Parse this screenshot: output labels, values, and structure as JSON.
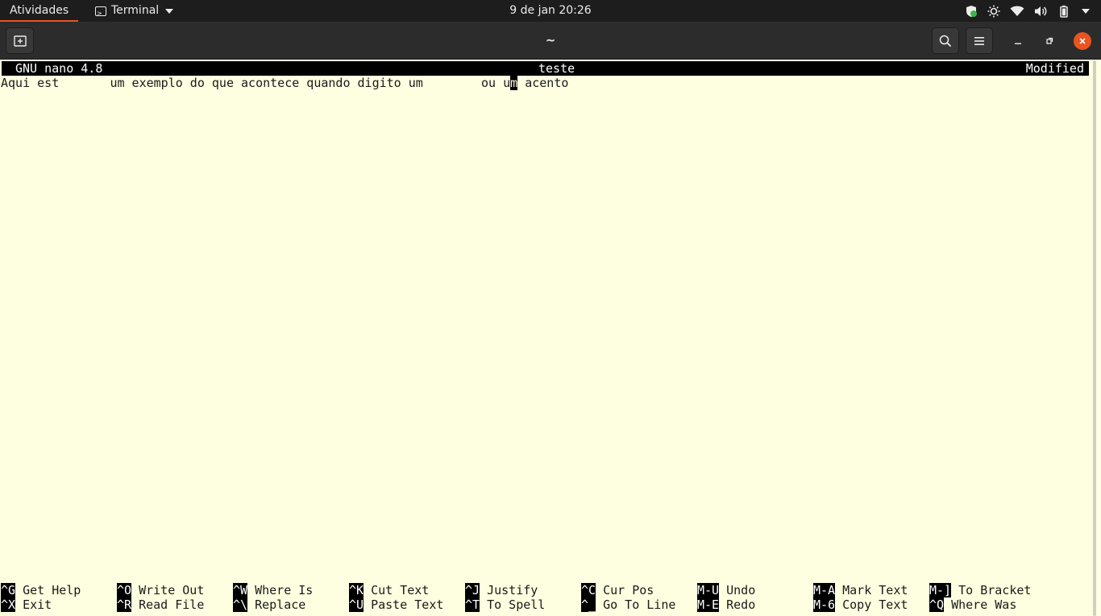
{
  "topbar": {
    "activities": "Atividades",
    "app_name": "Terminal",
    "clock": "9 de jan  20:26",
    "tray_icons": [
      "shield-icon",
      "brightness-icon",
      "wifi-icon",
      "volume-icon",
      "battery-icon",
      "system-menu-caret-icon"
    ]
  },
  "window": {
    "title": "~"
  },
  "nano": {
    "version": "GNU nano 4.8",
    "filename": "teste",
    "status": "Modified",
    "text_before_cursor": "Aqui est       um exemplo do que acontece quando digito um        ou u",
    "cursor_char": "m",
    "text_after_cursor": " acento",
    "shortcuts_row1": [
      {
        "key": "^G",
        "label": "Get Help"
      },
      {
        "key": "^O",
        "label": "Write Out"
      },
      {
        "key": "^W",
        "label": "Where Is"
      },
      {
        "key": "^K",
        "label": "Cut Text"
      },
      {
        "key": "^J",
        "label": "Justify"
      },
      {
        "key": "^C",
        "label": "Cur Pos"
      },
      {
        "key": "M-U",
        "label": "Undo"
      },
      {
        "key": "M-A",
        "label": "Mark Text"
      },
      {
        "key": "M-]",
        "label": "To Bracket"
      }
    ],
    "shortcuts_row2": [
      {
        "key": "^X",
        "label": "Exit"
      },
      {
        "key": "^R",
        "label": "Read File"
      },
      {
        "key": "^\\",
        "label": "Replace"
      },
      {
        "key": "^U",
        "label": "Paste Text"
      },
      {
        "key": "^T",
        "label": "To Spell"
      },
      {
        "key": "^_",
        "label": "Go To Line"
      },
      {
        "key": "M-E",
        "label": "Redo"
      },
      {
        "key": "M-6",
        "label": "Copy Text"
      },
      {
        "key": "^Q",
        "label": "Where Was"
      }
    ]
  },
  "colors": {
    "accent": "#e95420",
    "terminal_bg": "#fefee0",
    "topbar_bg": "#1d1d1d",
    "headerbar_bg": "#2c2c2c"
  }
}
